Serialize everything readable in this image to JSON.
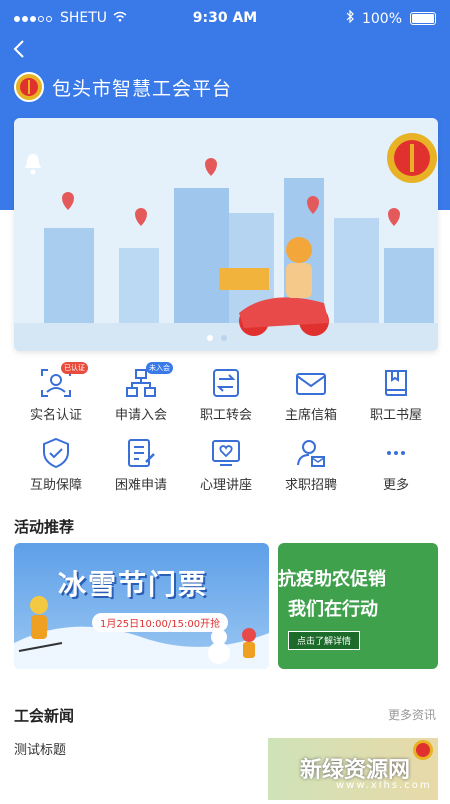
{
  "status_bar": {
    "carrier": "SHETU",
    "time": "9:30 AM",
    "battery": "100%"
  },
  "header": {
    "title": "包头市智慧工会平台",
    "back_icon": "chevron-left-icon"
  },
  "banner": {
    "carousel_index": 1,
    "carousel_count": 2
  },
  "services": [
    {
      "label": "实名认证",
      "badge": "已认证",
      "icon": "id-card-icon"
    },
    {
      "label": "申请入会",
      "badge": "未入会",
      "icon": "org-chart-icon"
    },
    {
      "label": "职工转会",
      "badge": "",
      "icon": "transfer-icon"
    },
    {
      "label": "主席信箱",
      "badge": "",
      "icon": "mail-icon"
    },
    {
      "label": "职工书屋",
      "badge": "",
      "icon": "book-icon"
    },
    {
      "label": "互助保障",
      "badge": "",
      "icon": "shield-check-icon"
    },
    {
      "label": "困难申请",
      "badge": "",
      "icon": "document-edit-icon"
    },
    {
      "label": "心理讲座",
      "badge": "",
      "icon": "heart-screen-icon"
    },
    {
      "label": "求职招聘",
      "badge": "",
      "icon": "user-mail-icon"
    },
    {
      "label": "更多",
      "badge": "",
      "icon": "more-dots-icon"
    }
  ],
  "activities": {
    "title": "活动推荐",
    "cards": [
      {
        "headline": "冰雪节门票",
        "sub": "1月25日10:00/15:00开抢"
      },
      {
        "headline_1": "抗疫助农促销",
        "headline_2": "我们在行动",
        "button": "点击了解详情"
      }
    ]
  },
  "news": {
    "title": "工会新闻",
    "more": "更多资讯",
    "items": [
      {
        "title": "测试标题"
      }
    ]
  },
  "watermark": {
    "text": "新绿资源网",
    "url": "www.xlhs.com"
  },
  "colors": {
    "primary": "#3a7ae8",
    "badge_red": "#e74c3c",
    "promo_green": "#3fa14c"
  }
}
